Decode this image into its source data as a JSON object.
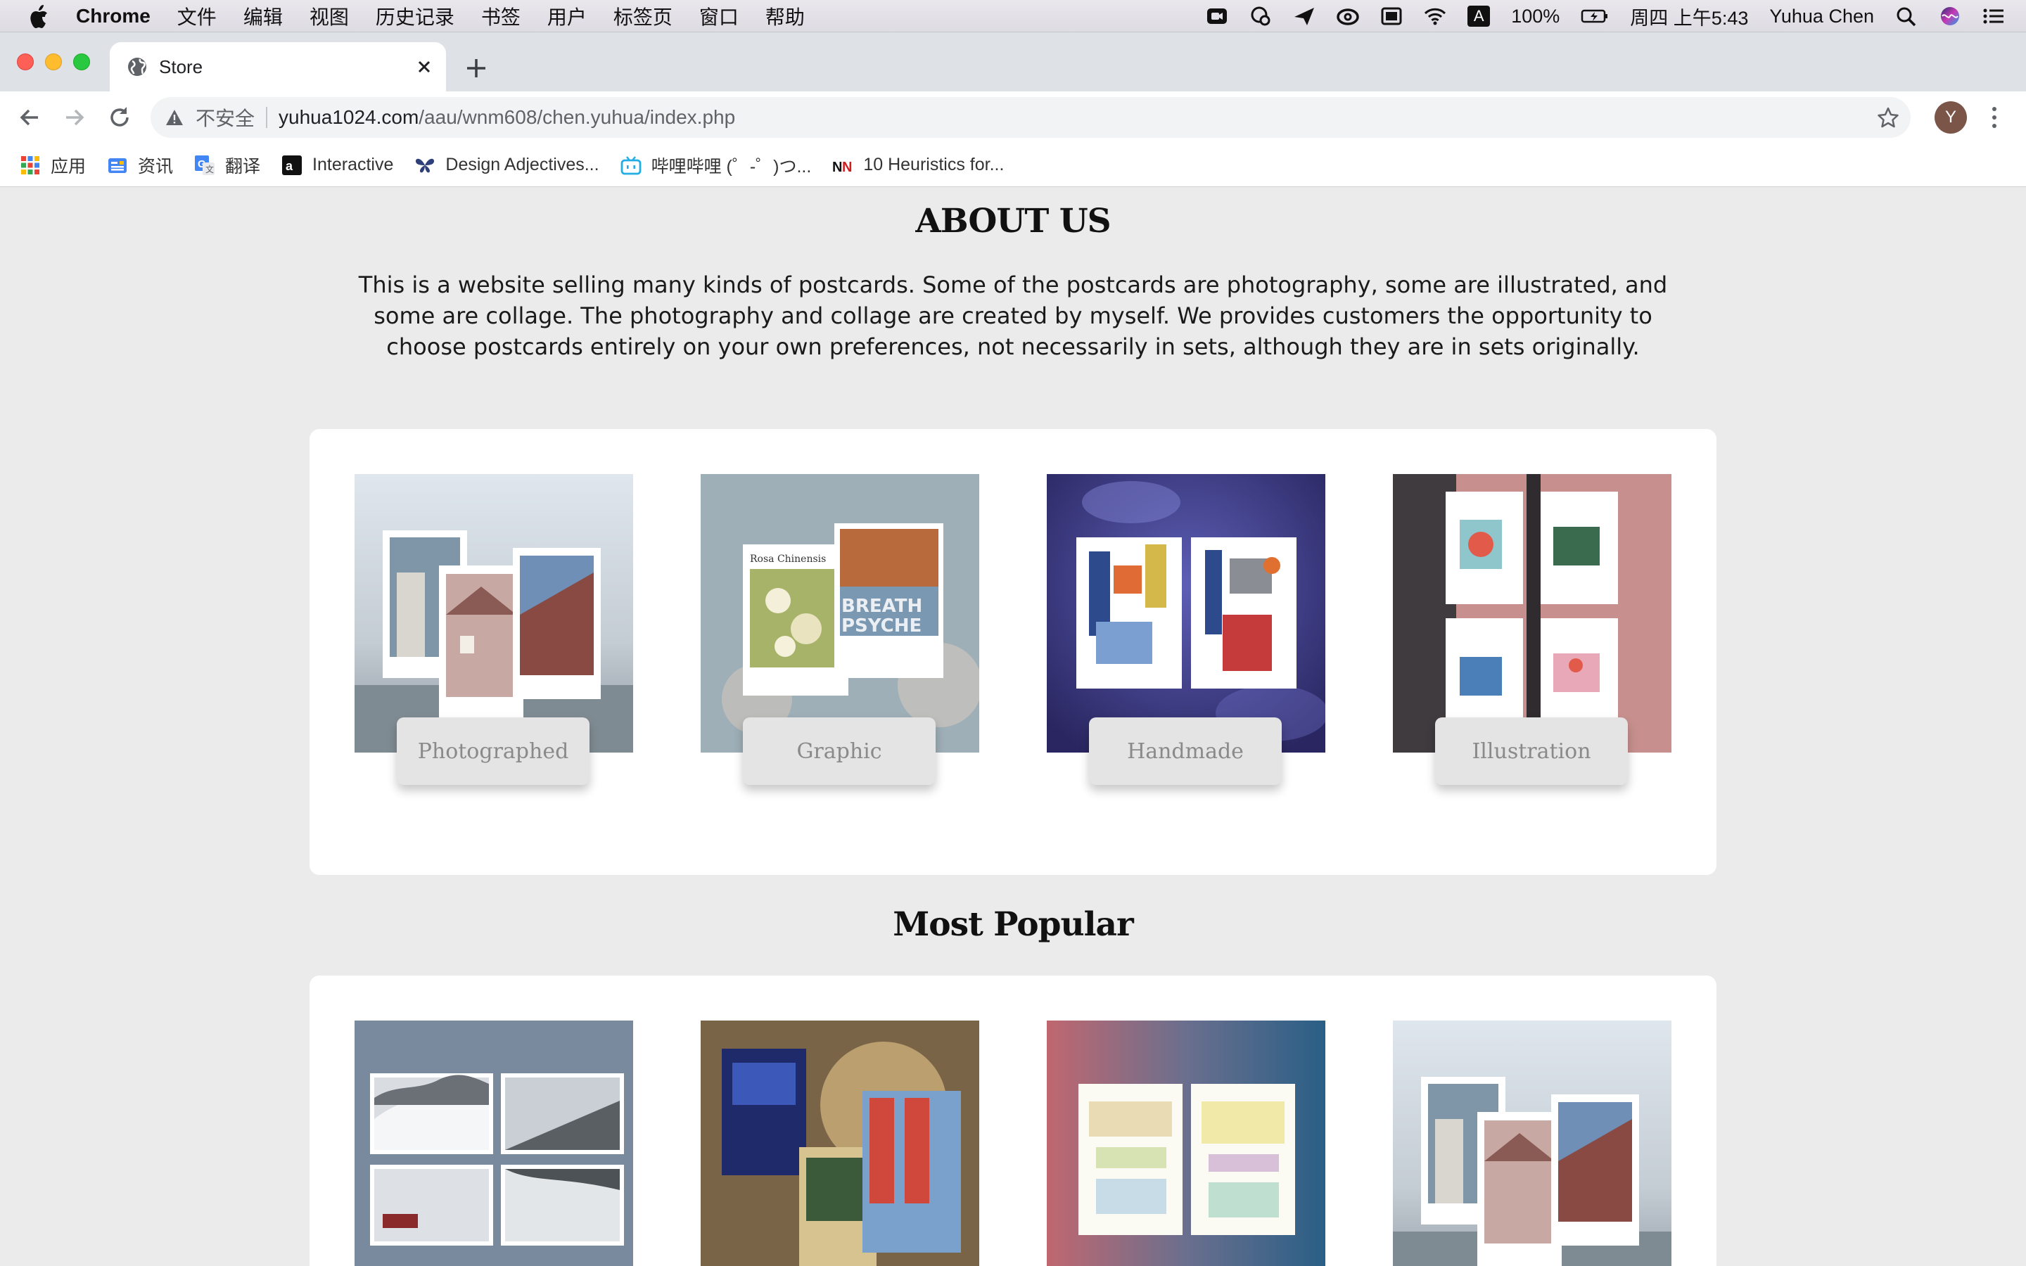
{
  "menubar": {
    "app_name": "Chrome",
    "items": [
      "文件",
      "编辑",
      "视图",
      "历史记录",
      "书签",
      "用户",
      "标签页",
      "窗口",
      "帮助"
    ],
    "battery": "100%",
    "clock": "周四 上午5:43",
    "user": "Yuhua Chen",
    "input_method": "A"
  },
  "browser": {
    "tab_title": "Store",
    "insecure_label": "不安全",
    "url_host": "yuhua1024.com",
    "url_path": "/aau/wnm608/chen.yuhua/index.php",
    "avatar_letter": "Y",
    "bookmarks": [
      {
        "label": "应用",
        "icon": "apps-grid-icon"
      },
      {
        "label": "资讯",
        "icon": "news-icon"
      },
      {
        "label": "翻译",
        "icon": "translate-icon"
      },
      {
        "label": "Interactive",
        "icon": "interactive-icon"
      },
      {
        "label": "Design Adjectives...",
        "icon": "butterfly-icon"
      },
      {
        "label": "哔哩哔哩 (゜-゜)つ...",
        "icon": "bilibili-icon"
      },
      {
        "label": "10 Heuristics for...",
        "icon": "nn-icon"
      }
    ]
  },
  "about": {
    "title": "ABOUT US",
    "text": "This is a website selling many kinds of postcards. Some of the postcards are photography, some are illustrated, and some are collage. The photography and collage are created by myself. We provides customers the opportunity to choose postcards entirely on your own preferences, not necessarily in sets, although they are in sets originally."
  },
  "categories": [
    {
      "label": "Photographed"
    },
    {
      "label": "Graphic"
    },
    {
      "label": "Handmade"
    },
    {
      "label": "Illustration"
    }
  ],
  "popular": {
    "title": "Most Popular"
  }
}
